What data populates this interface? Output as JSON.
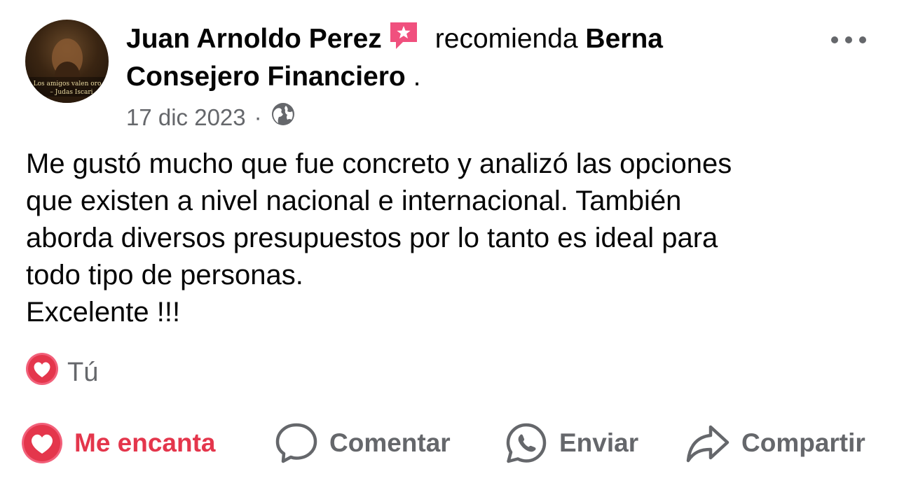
{
  "post": {
    "author_name": "Juan Arnoldo Perez",
    "action_text": "recomienda",
    "page_name_line1": "Berna",
    "page_name_line2": "Consejero Financiero",
    "trailing_period": ".",
    "date": "17 dic 2023",
    "separator": "·",
    "privacy_icon": "globe-icon",
    "body_lines": [
      "Me gustó mucho que fue concreto y analizó las opciones",
      "que existen a nivel nacional e internacional. También",
      "aborda diversos presupuestos por lo tanto es ideal para",
      "todo tipo de personas.",
      "Excelente !!!"
    ],
    "avatar": {
      "caption_line1": "Los amigos valen oro",
      "caption_line2": "– Judas Iscari"
    }
  },
  "reactions": {
    "icon": "heart-reaction-icon",
    "label": "Tú"
  },
  "actions": {
    "love": "Me encanta",
    "comment": "Comentar",
    "send": "Enviar",
    "share": "Compartir"
  },
  "colors": {
    "love_red": "#e4364c",
    "secondary_gray": "#65676b",
    "recommend_pink": "#f0507e"
  }
}
